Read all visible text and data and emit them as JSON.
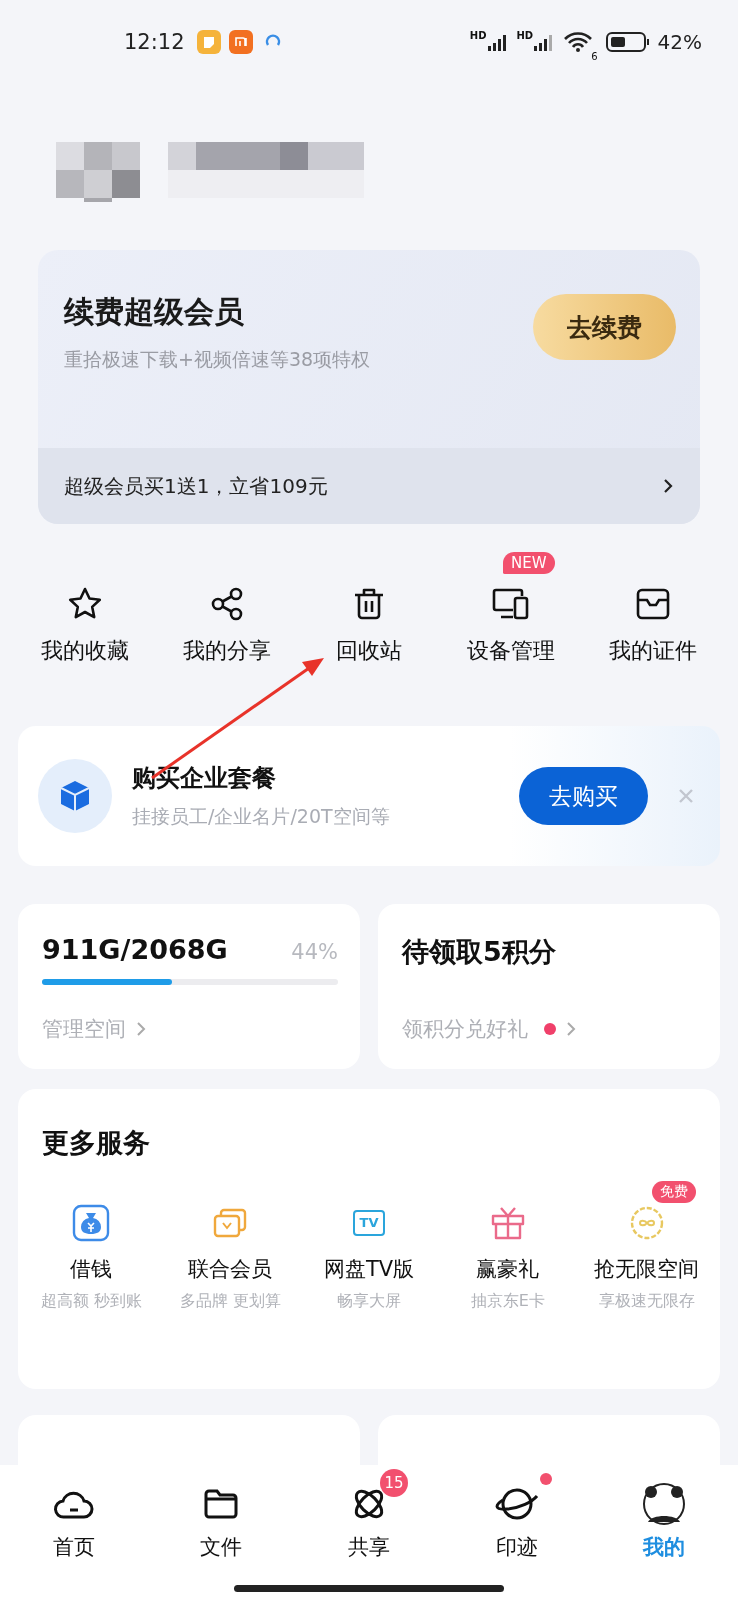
{
  "status_bar": {
    "time": "12:12",
    "signal_labels": [
      "HD",
      "HD"
    ],
    "wifi_label": "6",
    "battery": "42%"
  },
  "membership": {
    "title": "续费超级会员",
    "subtitle": "重拾极速下载+视频倍速等38项特权",
    "button": "去续费",
    "promo": "超级会员买1送1，立省109元"
  },
  "shortcuts": [
    {
      "label": "我的收藏",
      "kind": "star"
    },
    {
      "label": "我的分享",
      "kind": "share"
    },
    {
      "label": "回收站",
      "kind": "trash"
    },
    {
      "label": "设备管理",
      "kind": "devices",
      "badge": "NEW"
    },
    {
      "label": "我的证件",
      "kind": "card"
    }
  ],
  "enterprise": {
    "title": "购买企业套餐",
    "subtitle": "挂接员工/企业名片/20T空间等",
    "button": "去购买"
  },
  "storage": {
    "usage": "911G/2068G",
    "percent": "44%",
    "level": 0.44,
    "link": "管理空间"
  },
  "points": {
    "title": "待领取5积分",
    "link": "领积分兑好礼",
    "unread": true
  },
  "services": {
    "title": "更多服务",
    "items": [
      {
        "name": "借钱",
        "desc": "超高额 秒到账",
        "kind": "money"
      },
      {
        "name": "联合会员",
        "desc": "多品牌 更划算",
        "kind": "vip"
      },
      {
        "name": "网盘TV版",
        "desc": "畅享大屏",
        "kind": "tv",
        "icon_text": "TV"
      },
      {
        "name": "赢豪礼",
        "desc": "抽京东E卡",
        "kind": "gift"
      },
      {
        "name": "抢无限空间",
        "desc": "享极速无限存",
        "kind": "infinite",
        "badge": "免费"
      }
    ]
  },
  "nav": [
    {
      "label": "首页",
      "kind": "cloud",
      "selected": false
    },
    {
      "label": "文件",
      "kind": "folder",
      "selected": false
    },
    {
      "label": "共享",
      "kind": "atom",
      "selected": false,
      "badge": "15"
    },
    {
      "label": "印迹",
      "kind": "planet",
      "selected": false,
      "dot": true
    },
    {
      "label": "我的",
      "kind": "avatar",
      "selected": true
    }
  ]
}
